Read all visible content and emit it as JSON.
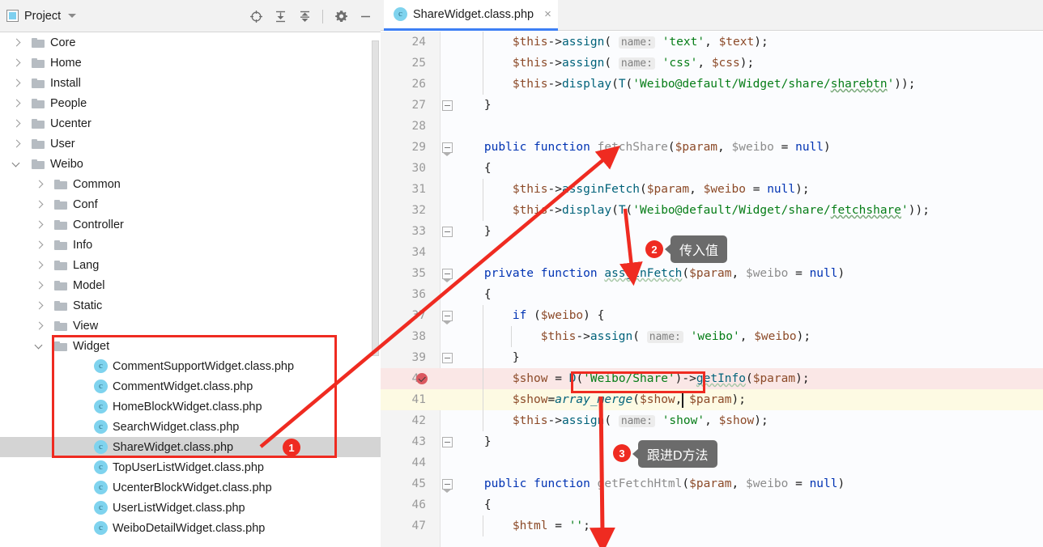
{
  "sidebar": {
    "title": "Project",
    "title_icon": "project-panel-icon",
    "toolbar": [
      {
        "name": "locate-target-icon",
        "glyph": "locate"
      },
      {
        "name": "expand-all-icon",
        "glyph": "expand"
      },
      {
        "name": "collapse-all-icon",
        "glyph": "collapse"
      },
      {
        "name": "settings-gear-icon",
        "glyph": "gear"
      },
      {
        "name": "hide-panel-icon",
        "glyph": "minus"
      }
    ],
    "tree": [
      {
        "label": "Core",
        "type": "folder",
        "indent": 1,
        "state": "closed"
      },
      {
        "label": "Home",
        "type": "folder",
        "indent": 1,
        "state": "closed"
      },
      {
        "label": "Install",
        "type": "folder",
        "indent": 1,
        "state": "closed"
      },
      {
        "label": "People",
        "type": "folder",
        "indent": 1,
        "state": "closed"
      },
      {
        "label": "Ucenter",
        "type": "folder",
        "indent": 1,
        "state": "closed"
      },
      {
        "label": "User",
        "type": "folder",
        "indent": 1,
        "state": "closed"
      },
      {
        "label": "Weibo",
        "type": "folder",
        "indent": 1,
        "state": "open"
      },
      {
        "label": "Common",
        "type": "folder",
        "indent": 2,
        "state": "closed"
      },
      {
        "label": "Conf",
        "type": "folder",
        "indent": 2,
        "state": "closed"
      },
      {
        "label": "Controller",
        "type": "folder",
        "indent": 2,
        "state": "closed"
      },
      {
        "label": "Info",
        "type": "folder",
        "indent": 2,
        "state": "closed"
      },
      {
        "label": "Lang",
        "type": "folder",
        "indent": 2,
        "state": "closed"
      },
      {
        "label": "Model",
        "type": "folder",
        "indent": 2,
        "state": "closed"
      },
      {
        "label": "Static",
        "type": "folder",
        "indent": 2,
        "state": "closed"
      },
      {
        "label": "View",
        "type": "folder",
        "indent": 2,
        "state": "closed"
      },
      {
        "label": "Widget",
        "type": "folder",
        "indent": 2,
        "state": "open"
      },
      {
        "label": "CommentSupportWidget.class.php",
        "type": "class",
        "indent": 3,
        "state": ""
      },
      {
        "label": "CommentWidget.class.php",
        "type": "class",
        "indent": 3,
        "state": ""
      },
      {
        "label": "HomeBlockWidget.class.php",
        "type": "class",
        "indent": 3,
        "state": ""
      },
      {
        "label": "SearchWidget.class.php",
        "type": "class",
        "indent": 3,
        "state": ""
      },
      {
        "label": "ShareWidget.class.php",
        "type": "class",
        "indent": 3,
        "state": "selected"
      },
      {
        "label": "TopUserListWidget.class.php",
        "type": "class",
        "indent": 3,
        "state": ""
      },
      {
        "label": "UcenterBlockWidget.class.php",
        "type": "class",
        "indent": 3,
        "state": ""
      },
      {
        "label": "UserListWidget.class.php",
        "type": "class",
        "indent": 3,
        "state": ""
      },
      {
        "label": "WeiboDetailWidget.class.php",
        "type": "class",
        "indent": 3,
        "state": ""
      }
    ]
  },
  "editor": {
    "tab": {
      "label": "ShareWidget.class.php",
      "icon": "php-class-icon",
      "close_label": "×",
      "active_underline_color": "#3d7ff5"
    },
    "line_numbers": [
      "24",
      "25",
      "26",
      "27",
      "28",
      "29",
      "30",
      "31",
      "32",
      "33",
      "34",
      "35",
      "36",
      "37",
      "38",
      "39",
      "40",
      "41",
      "42",
      "43",
      "44",
      "45",
      "46",
      "47"
    ],
    "lines": [
      {
        "n": "24",
        "text": "        $this->assign( name: 'text', $text);"
      },
      {
        "n": "25",
        "text": "        $this->assign( name: 'css', $css);"
      },
      {
        "n": "26",
        "text": "        $this->display(T('Weibo@default/Widget/share/sharebtn'));"
      },
      {
        "n": "27",
        "text": "    }"
      },
      {
        "n": "28",
        "text": ""
      },
      {
        "n": "29",
        "text": "    public function fetchShare($param, $weibo = null)"
      },
      {
        "n": "30",
        "text": "    {"
      },
      {
        "n": "31",
        "text": "        $this->assginFetch($param, $weibo = null);"
      },
      {
        "n": "32",
        "text": "        $this->display(T('Weibo@default/Widget/share/fetchshare'));"
      },
      {
        "n": "33",
        "text": "    }"
      },
      {
        "n": "34",
        "text": ""
      },
      {
        "n": "35",
        "text": "    private function assginFetch($param, $weibo = null)"
      },
      {
        "n": "36",
        "text": "    {"
      },
      {
        "n": "37",
        "text": "        if ($weibo) {"
      },
      {
        "n": "38",
        "text": "            $this->assign( name: 'weibo', $weibo);"
      },
      {
        "n": "39",
        "text": "        }"
      },
      {
        "n": "40",
        "text": "        $show = D('Weibo/Share')->getInfo($param);"
      },
      {
        "n": "41",
        "text": "        $show=array_merge($show, $param);"
      },
      {
        "n": "42",
        "text": "        $this->assign( name: 'show', $show);"
      },
      {
        "n": "43",
        "text": "    }"
      },
      {
        "n": "44",
        "text": ""
      },
      {
        "n": "45",
        "text": "    public function getFetchHtml($param, $weibo = null)"
      },
      {
        "n": "46",
        "text": "    {"
      },
      {
        "n": "47",
        "text": "        $html = '';"
      }
    ],
    "breakpoint_line": "40",
    "current_line": "41",
    "breakpoint_icon": "breakpoint-verified-icon",
    "highlight_colors": {
      "breakpoint_line_bg": "#fae7e6",
      "current_line_bg": "#fdfae3",
      "keyword": "#0033b3",
      "string": "#067d17",
      "variable": "#8c4a28",
      "function": "#00627a",
      "parameter_hint": "#808080"
    }
  },
  "annotations": {
    "accent_color": "#ef2b21",
    "callout_bg": "#6b6b6b",
    "steps": [
      {
        "badge": "1",
        "label": ""
      },
      {
        "badge": "2",
        "label": "传入值"
      },
      {
        "badge": "3",
        "label": "跟进D方法"
      }
    ],
    "boxes": [
      {
        "name": "widget-folder-highlight-box"
      },
      {
        "name": "d-call-highlight-box"
      }
    ]
  }
}
